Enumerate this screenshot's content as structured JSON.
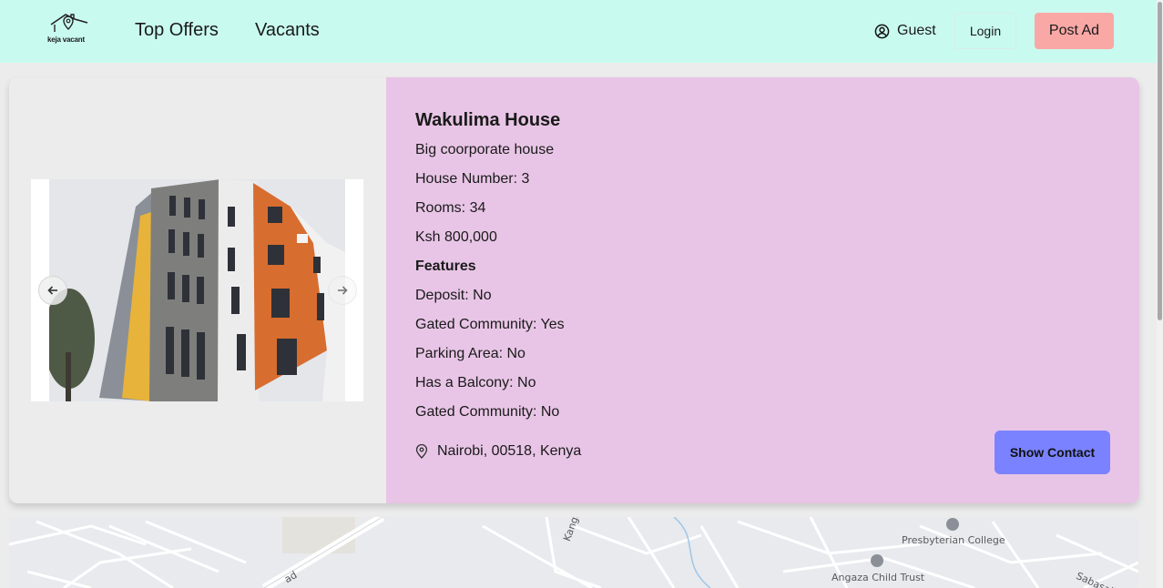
{
  "nav": {
    "logo_text": "keja vacant",
    "links": [
      "Top Offers",
      "Vacants"
    ],
    "guest_label": "Guest",
    "login_label": "Login",
    "post_ad_label": "Post Ad"
  },
  "listing": {
    "title": "Wakulima House",
    "description": "Big coorporate house",
    "house_number": "House Number: 3",
    "rooms": "Rooms: 34",
    "price": "Ksh 800,000",
    "features_heading": "Features",
    "features": [
      "Deposit: No",
      "Gated Community: Yes",
      "Parking Area: No",
      "Has a Balcony: No",
      "Gated Community: No"
    ],
    "location": "Nairobi, 00518, Kenya",
    "contact_label": "Show Contact"
  },
  "map": {
    "labels": [
      "Presbyterian College",
      "Angaza Child Trust",
      "Kangaru",
      "Sabasaba",
      "ad"
    ]
  },
  "colors": {
    "nav_bg": "#c9faf0",
    "details_bg": "#e8c5e6",
    "post_ad": "#f9a8a5",
    "contact": "#7a82ff"
  }
}
